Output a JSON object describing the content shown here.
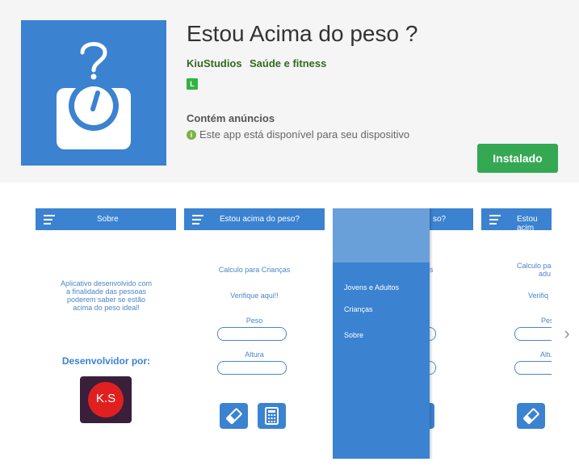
{
  "app": {
    "title": "Estou Acima do peso ?",
    "developer": "KiuStudios",
    "category": "Saúde e fitness",
    "content_rating": "L",
    "ads_notice": "Contém anúncios",
    "availability": "Este app está disponível para seu dispositivo",
    "install_label": "Instalado"
  },
  "screenshots": {
    "s1": {
      "bar_title": "Sobre",
      "about_text": [
        "Aplicativo desenvolvido com",
        "a finalidade das pessoas",
        "poderem saber se estão",
        "acima do peso ideal!"
      ],
      "developer_heading": "Desenvolvidor por:",
      "logo_text": "K.S"
    },
    "s2": {
      "bar_title": "Estou acima do peso?",
      "calc_children": "Calculo para Crianças",
      "check_here": "Verifique aqui!!",
      "weight_label": "Peso",
      "height_label": "Altura"
    },
    "s3": {
      "bar_title_partial": "so?",
      "calc_partial": "s",
      "menu": [
        "Jovens e Adultos",
        "Crianças",
        "Sobre"
      ]
    },
    "s4": {
      "bar_title": "Estou acim",
      "calc_partial_1": "Calculo pa",
      "calc_partial_2": "adu",
      "check_partial": "Verifiq",
      "weight_partial": "Pes",
      "height_partial": "Altu"
    }
  },
  "colors": {
    "brand_blue": "#3b82d1",
    "install_green": "#34a853",
    "dev_green": "#33691e"
  }
}
